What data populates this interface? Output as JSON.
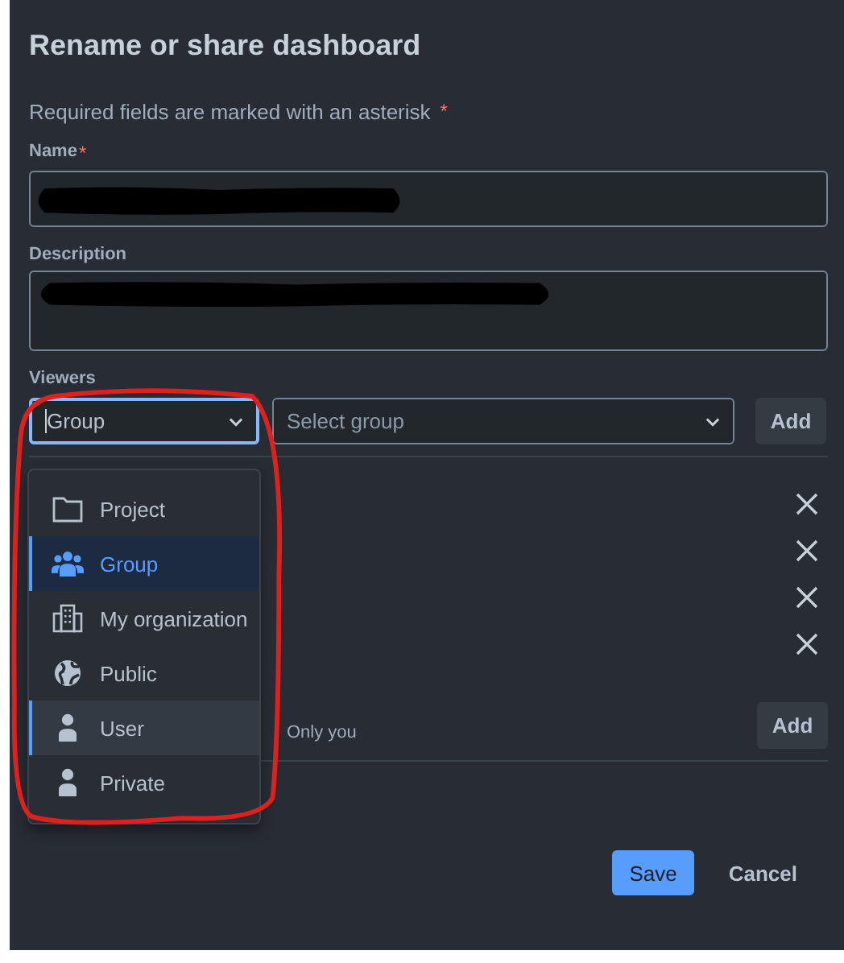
{
  "dialog": {
    "title": "Rename or share dashboard",
    "required_note": "Required fields are marked with an asterisk",
    "required_mark": "*"
  },
  "fields": [
    {
      "label": "Name",
      "required": true,
      "redacted": true,
      "kind": "input"
    },
    {
      "label": "Description",
      "required": false,
      "redacted": true,
      "kind": "textarea"
    }
  ],
  "viewers": {
    "label": "Viewers",
    "type_select": {
      "value": "Group",
      "focused": true
    },
    "target_select": {
      "placeholder": "Select group"
    },
    "add_button": "Add",
    "rows": [
      {
        "removable": true
      },
      {
        "removable": true
      },
      {
        "removable": true
      },
      {
        "removable": true
      }
    ]
  },
  "editors": {
    "note": "Only you",
    "add_button": "Add"
  },
  "dropdown": {
    "options": [
      {
        "label": "Project",
        "kind": "folder",
        "selected": false,
        "highlighted": false
      },
      {
        "label": "Group",
        "kind": "people",
        "selected": true,
        "highlighted": false
      },
      {
        "label": "My organization",
        "kind": "building",
        "selected": false,
        "highlighted": false
      },
      {
        "label": "Public",
        "kind": "globe",
        "selected": false,
        "highlighted": false
      },
      {
        "label": "User",
        "kind": "person",
        "selected": false,
        "highlighted": true
      },
      {
        "label": "Private",
        "kind": "person",
        "selected": false,
        "highlighted": false
      }
    ]
  },
  "buttons": [
    {
      "label": "Save",
      "kind": "primary"
    },
    {
      "label": "Cancel",
      "kind": "subtle"
    }
  ],
  "annotation": {
    "kind": "circle"
  }
}
